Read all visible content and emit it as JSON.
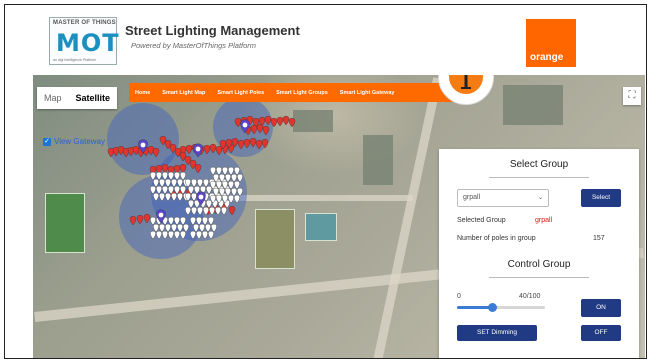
{
  "header": {
    "logo_top": "MASTER OF THINGS",
    "logo_main": "MOT",
    "logo_sub": "an digi Intelligence Platform",
    "title": "Street Lighting Management",
    "subtitle": "Powered by MasterOfThings Platform",
    "brand_logo": "orange"
  },
  "map": {
    "type_buttons": [
      "Map",
      "Satellite"
    ],
    "active_type": "Satellite",
    "fullscreen_icon": "fullscreen-icon",
    "view_gateway_label": "View Gateway",
    "view_gateway_checked": true
  },
  "nav": {
    "items": [
      "Home",
      "Smart Light Map",
      "Smart Light Poles",
      "Smart Light Groups",
      "Smart Light Gateway"
    ]
  },
  "app_icon": "street-lamp-icon",
  "panel": {
    "select_group_title": "Select Group",
    "select_value": "grpall",
    "select_button": "Select",
    "selected_group_label": "Selected Group",
    "selected_group_value": "grpall",
    "poles_label": "Number of poles in group",
    "poles_value": "157",
    "control_group_title": "Control Group",
    "slider_min": "0",
    "slider_value": "40/100",
    "slider_fraction": 0.4,
    "on_button": "ON",
    "set_dimming_button": "SET Dimming",
    "off_button": "OFF"
  },
  "colors": {
    "accent_orange": "#ff6a00",
    "button_navy": "#213a84",
    "pin_red": "#e0342c",
    "gateway_purple": "#5b45c9",
    "coverage_blue": "#3b5fc0"
  }
}
